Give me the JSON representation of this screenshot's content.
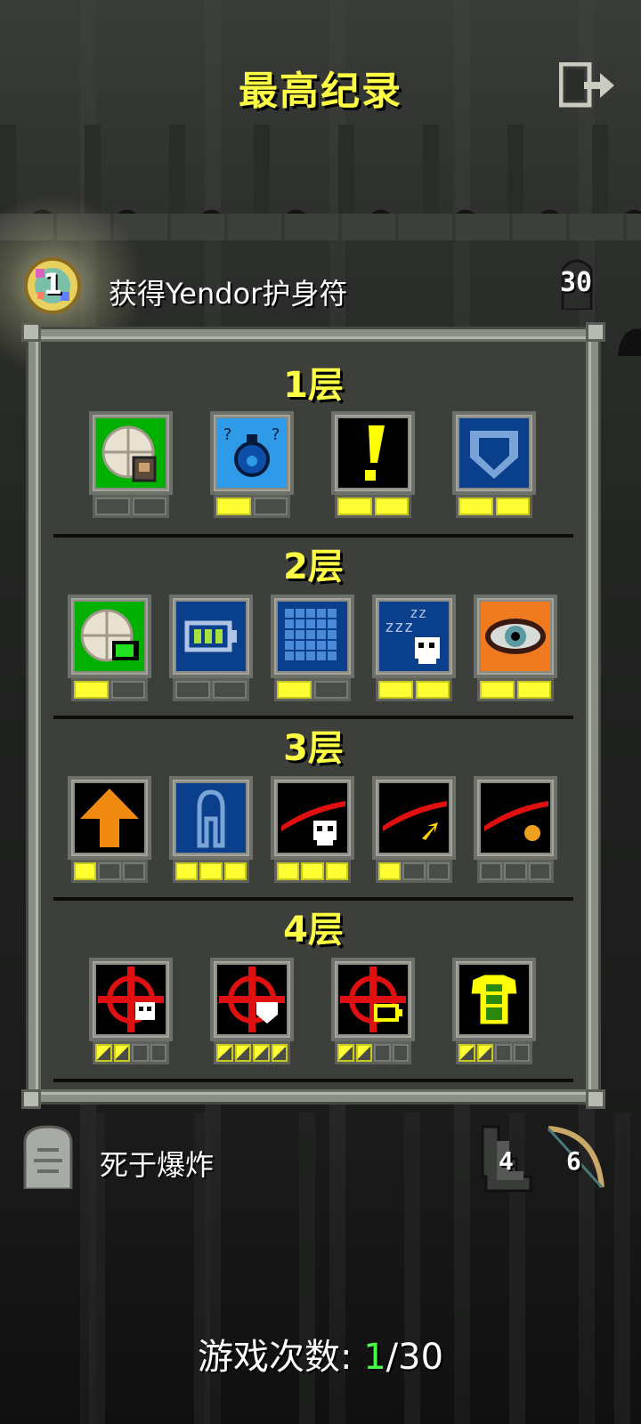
{
  "header": {
    "title": "最高纪录",
    "exit_icon": "exit-icon"
  },
  "record": {
    "badge_number": "1",
    "description": "获得Yendor护身符",
    "depth": "30"
  },
  "tiers": [
    {
      "label": "1层"
    },
    {
      "label": "2层"
    },
    {
      "label": "3层"
    },
    {
      "label": "4层"
    }
  ],
  "footer": {
    "death_cause": "死于爆炸",
    "boots_level": "4",
    "weapon_level": "6",
    "games_label": "游戏次数: ",
    "games_current": "1",
    "games_total": "/30"
  },
  "colors": {
    "title_yellow": "#ffff44",
    "pip_on": "#ffff33",
    "games_current": "#44ff44"
  }
}
